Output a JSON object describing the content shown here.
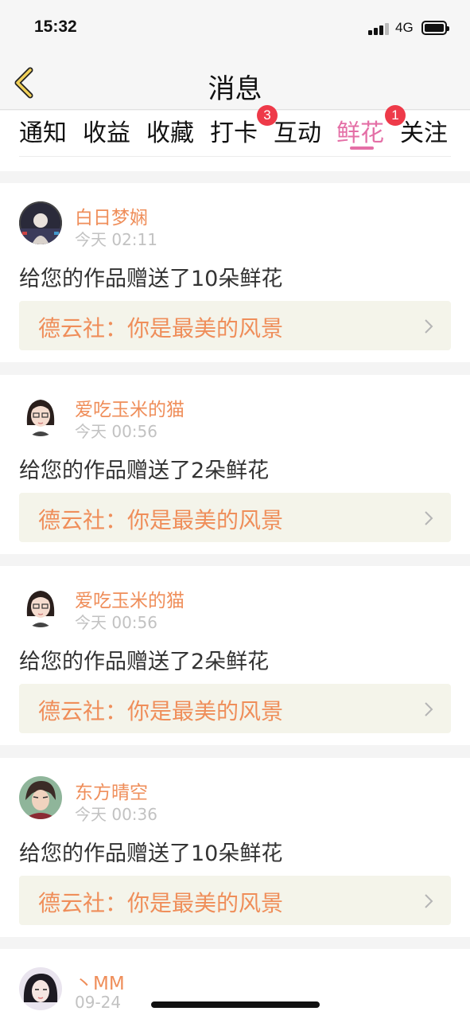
{
  "status_bar": {
    "time": "15:32",
    "network": "4G"
  },
  "header": {
    "title": "消息",
    "back_icon": "chevron-left-icon"
  },
  "tabs": [
    {
      "label": "通知",
      "badge": ""
    },
    {
      "label": "收益",
      "badge": ""
    },
    {
      "label": "收藏",
      "badge": ""
    },
    {
      "label": "打卡",
      "badge": "3"
    },
    {
      "label": "互动",
      "badge": ""
    },
    {
      "label": "鲜花",
      "badge": "1",
      "active": true
    },
    {
      "label": "关注",
      "badge": ""
    }
  ],
  "colors": {
    "accent": "#e46fa6",
    "name": "#ef8e5a",
    "badge": "#ee3a49",
    "link_bg": "#f4f4ea"
  },
  "messages": [
    {
      "user": "白日梦娴",
      "time": "今天 02:11",
      "text": "给您的作品赠送了10朵鲜花",
      "work": "德云社：你是最美的风景"
    },
    {
      "user": "爱吃玉米的猫",
      "time": "今天 00:56",
      "text": "给您的作品赠送了2朵鲜花",
      "work": "德云社：你是最美的风景"
    },
    {
      "user": "爱吃玉米的猫",
      "time": "今天 00:56",
      "text": "给您的作品赠送了2朵鲜花",
      "work": "德云社：你是最美的风景"
    },
    {
      "user": "东方晴空",
      "time": "今天 00:36",
      "text": "给您的作品赠送了10朵鲜花",
      "work": "德云社：你是最美的风景"
    },
    {
      "user": "丶MM",
      "time": "09-24",
      "text": "",
      "work": ""
    }
  ]
}
